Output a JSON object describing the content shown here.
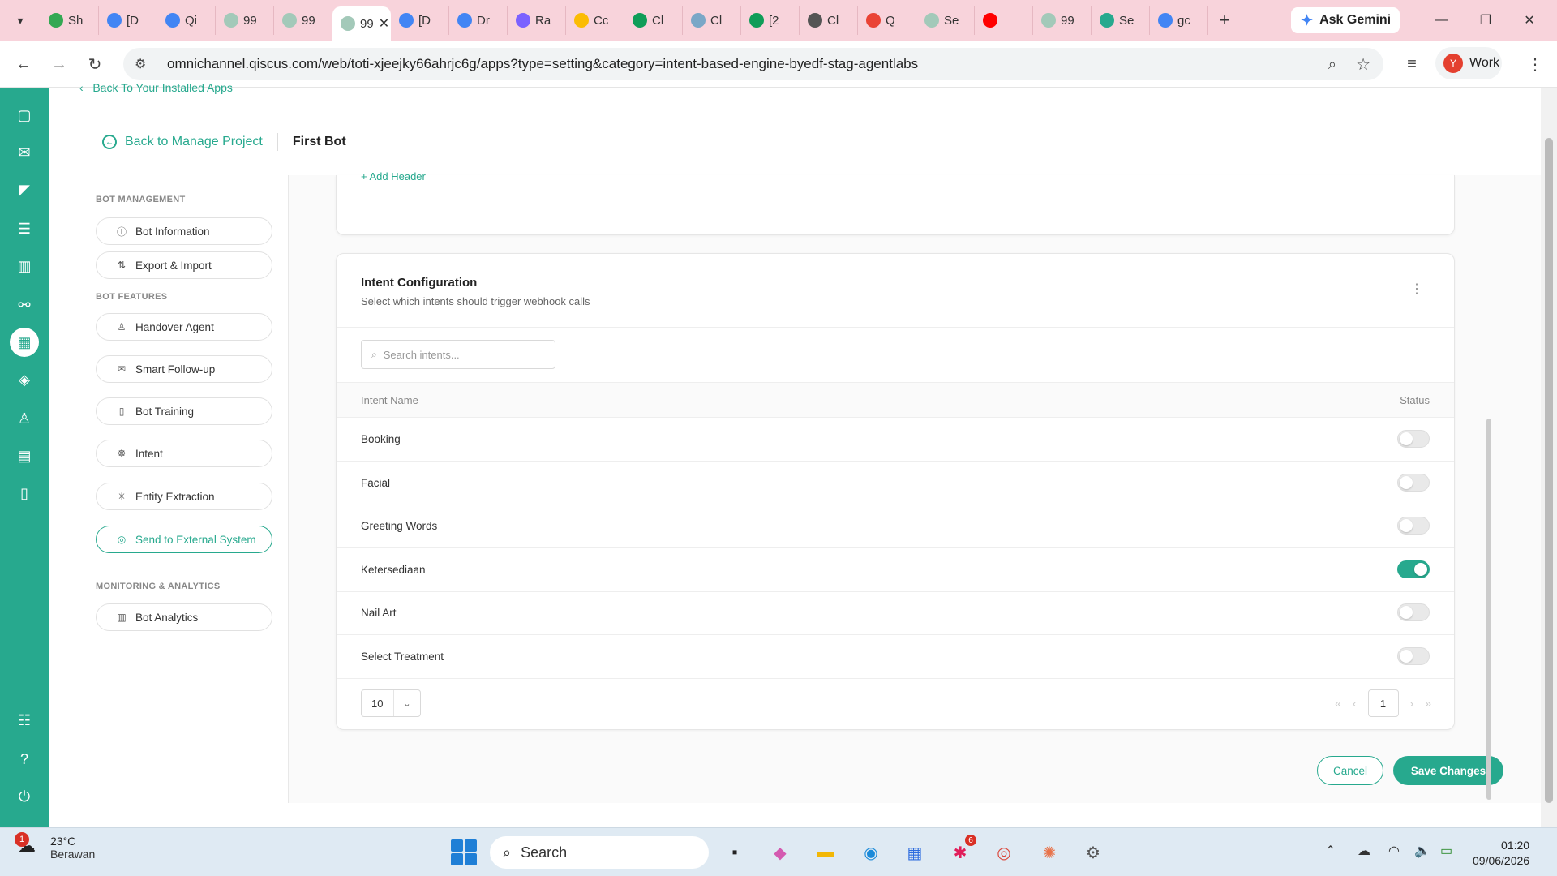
{
  "browser": {
    "tabs": [
      {
        "label": "Sh",
        "color": "#34a853"
      },
      {
        "label": "[D",
        "color": "#4285f4"
      },
      {
        "label": "Qi",
        "color": "#4285f4"
      },
      {
        "label": "99",
        "color": "#a3c9b9"
      },
      {
        "label": "99",
        "color": "#a3c9b9"
      },
      {
        "label": "99",
        "color": "#a3c9b9",
        "active": true
      },
      {
        "label": "[D",
        "color": "#4285f4"
      },
      {
        "label": "Dr",
        "color": "#4285f4"
      },
      {
        "label": "Ra",
        "color": "#7b61ff"
      },
      {
        "label": "Cc",
        "color": "#fbbc04"
      },
      {
        "label": "Cl",
        "color": "#0f9d58"
      },
      {
        "label": "Cl",
        "color": "#7aa7c7"
      },
      {
        "label": "[2",
        "color": "#0f9d58"
      },
      {
        "label": "Cl",
        "color": "#555555"
      },
      {
        "label": "Q",
        "color": "#ea4335"
      },
      {
        "label": "Se",
        "color": "#a3c9b9"
      },
      {
        "label": "",
        "color": "#ff0000"
      },
      {
        "label": "99",
        "color": "#a3c9b9"
      },
      {
        "label": "Se",
        "color": "#27a98e"
      },
      {
        "label": "gc",
        "color": "#4285f4"
      }
    ],
    "gemini_label": "Ask Gemini",
    "url": "omnichannel.qiscus.com/web/toti-xjeejky66ahrjc6g/apps?type=setting&category=intent-based-engine-byedf-stag-agentlabs",
    "profile_initial": "Y",
    "profile_label": "Work"
  },
  "app": {
    "back_apps": "Back To Your Installed Apps",
    "back_manage": "Back to Manage Project",
    "bot_name": "First Bot",
    "sidebar": {
      "sections": [
        {
          "title": "BOT MANAGEMENT"
        },
        {
          "title": "BOT FEATURES"
        },
        {
          "title": "MONITORING & ANALYTICS"
        }
      ],
      "items": [
        {
          "label": "Bot Information",
          "icon": "info-icon"
        },
        {
          "label": "Export & Import",
          "icon": "swap-icon"
        },
        {
          "label": "Handover Agent",
          "icon": "user-icon"
        },
        {
          "label": "Smart Follow-up",
          "icon": "message-icon"
        },
        {
          "label": "Bot Training",
          "icon": "book-icon"
        },
        {
          "label": "Intent",
          "icon": "brain-icon"
        },
        {
          "label": "Entity Extraction",
          "icon": "sparkle-icon"
        },
        {
          "label": "Send to External System",
          "icon": "target-icon",
          "active": true
        },
        {
          "label": "Bot Analytics",
          "icon": "chart-icon"
        }
      ]
    },
    "add_header": "+ Add Header",
    "intent_config": {
      "title": "Intent Configuration",
      "subtitle": "Select which intents should trigger webhook calls",
      "search_placeholder": "Search intents...",
      "col_name": "Intent Name",
      "col_status": "Status",
      "rows": [
        {
          "name": "Booking",
          "enabled": false
        },
        {
          "name": "Facial",
          "enabled": false
        },
        {
          "name": "Greeting Words",
          "enabled": false
        },
        {
          "name": "Ketersediaan",
          "enabled": true
        },
        {
          "name": "Nail Art",
          "enabled": false
        },
        {
          "name": "Select Treatment",
          "enabled": false
        }
      ],
      "page_size": "10",
      "current_page": "1"
    },
    "cancel_label": "Cancel",
    "save_label": "Save Changes",
    "accent_color": "#27a98e"
  },
  "taskbar": {
    "weather_temp": "23°C",
    "weather_desc": "Berawan",
    "weather_badge": "1",
    "search_label": "Search",
    "slack_badge": "6",
    "time": "01:20",
    "date": "09/06/2026"
  }
}
